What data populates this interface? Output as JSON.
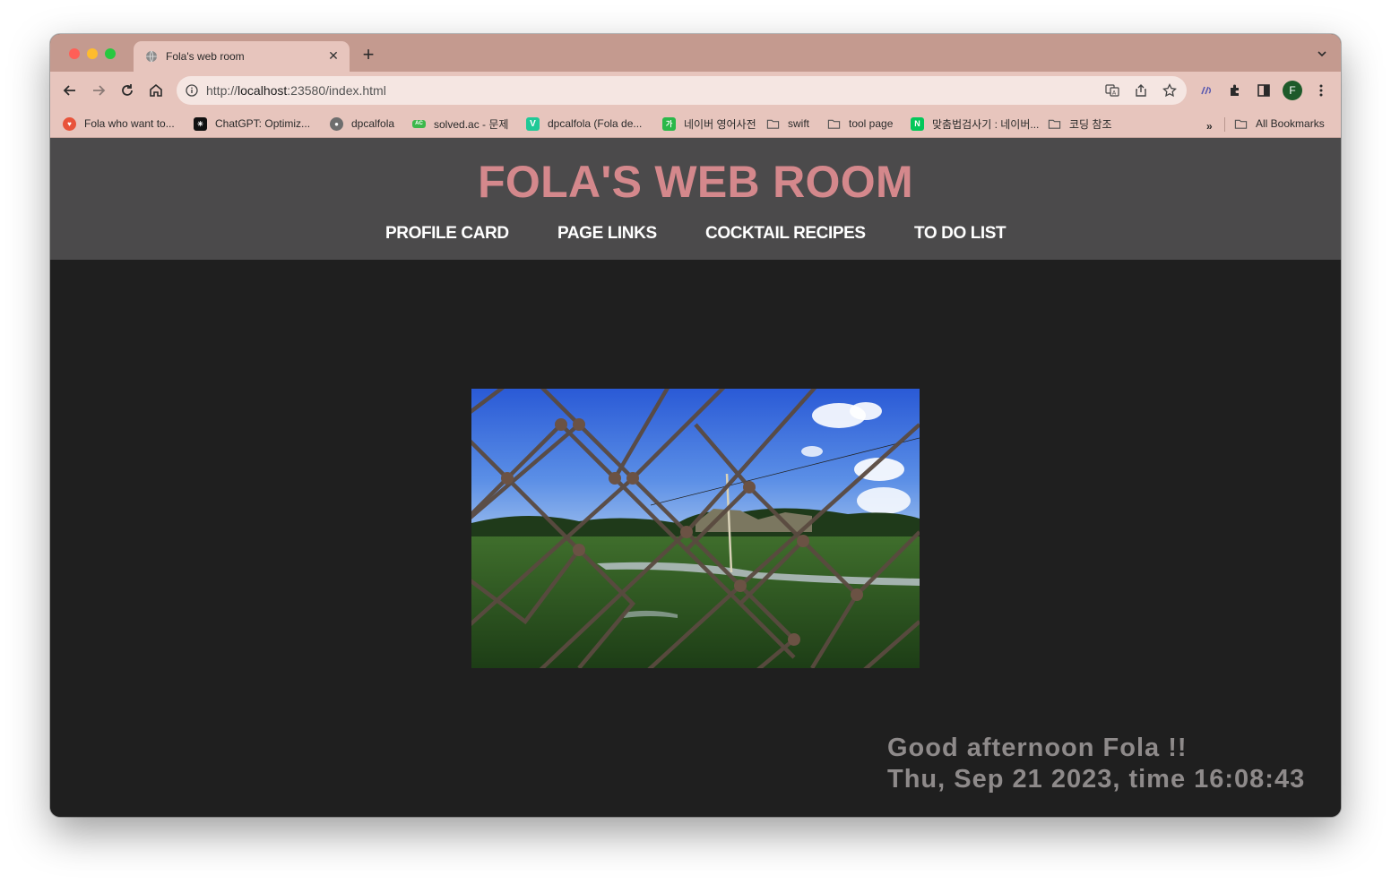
{
  "browser": {
    "tab": {
      "title": "Fola's web room",
      "close": "✕"
    },
    "newtab": "+",
    "address": {
      "scheme": "http://",
      "host": "localhost",
      "path": ":23580/index.html"
    },
    "profile_initial": "F",
    "bookmarks": [
      {
        "label": "Fola who want to...",
        "icon": "brave-icon"
      },
      {
        "label": "ChatGPT: Optimiz...",
        "icon": "chatgpt-icon"
      },
      {
        "label": "dpcalfola",
        "icon": "github-icon"
      },
      {
        "label": "solved.ac - 문제",
        "icon": "solvedac-icon"
      },
      {
        "label": "dpcalfola (Fola de...",
        "icon": "velog-icon"
      },
      {
        "label": "네이버 영어사전",
        "icon": "naver-dict-icon"
      },
      {
        "label": "swift",
        "icon": "folder-icon"
      },
      {
        "label": "tool page",
        "icon": "folder-icon"
      },
      {
        "label": "맞춤법검사기 : 네이버...",
        "icon": "naver-icon"
      },
      {
        "label": "코딩 참조",
        "icon": "folder-icon"
      }
    ],
    "bookmarks_overflow": "»",
    "all_bookmarks": "All Bookmarks"
  },
  "site": {
    "title": "FOLA'S WEB ROOM",
    "nav": [
      "PROFILE CARD",
      "PAGE LINKS",
      "COCKTAIL RECIPES",
      "TO DO LIST"
    ],
    "greeting": "Good afternoon Fola !!",
    "datetime": "Thu, Sep 21 2023, time 16:08:43"
  },
  "colors": {
    "title": "#d4888c",
    "header_bg": "#4b4a4b",
    "page_bg": "#1f1f1f",
    "greeting": "#8e8a8a",
    "browser_chrome": "#e7c5bd",
    "tabstrip": "#c49a8f"
  }
}
